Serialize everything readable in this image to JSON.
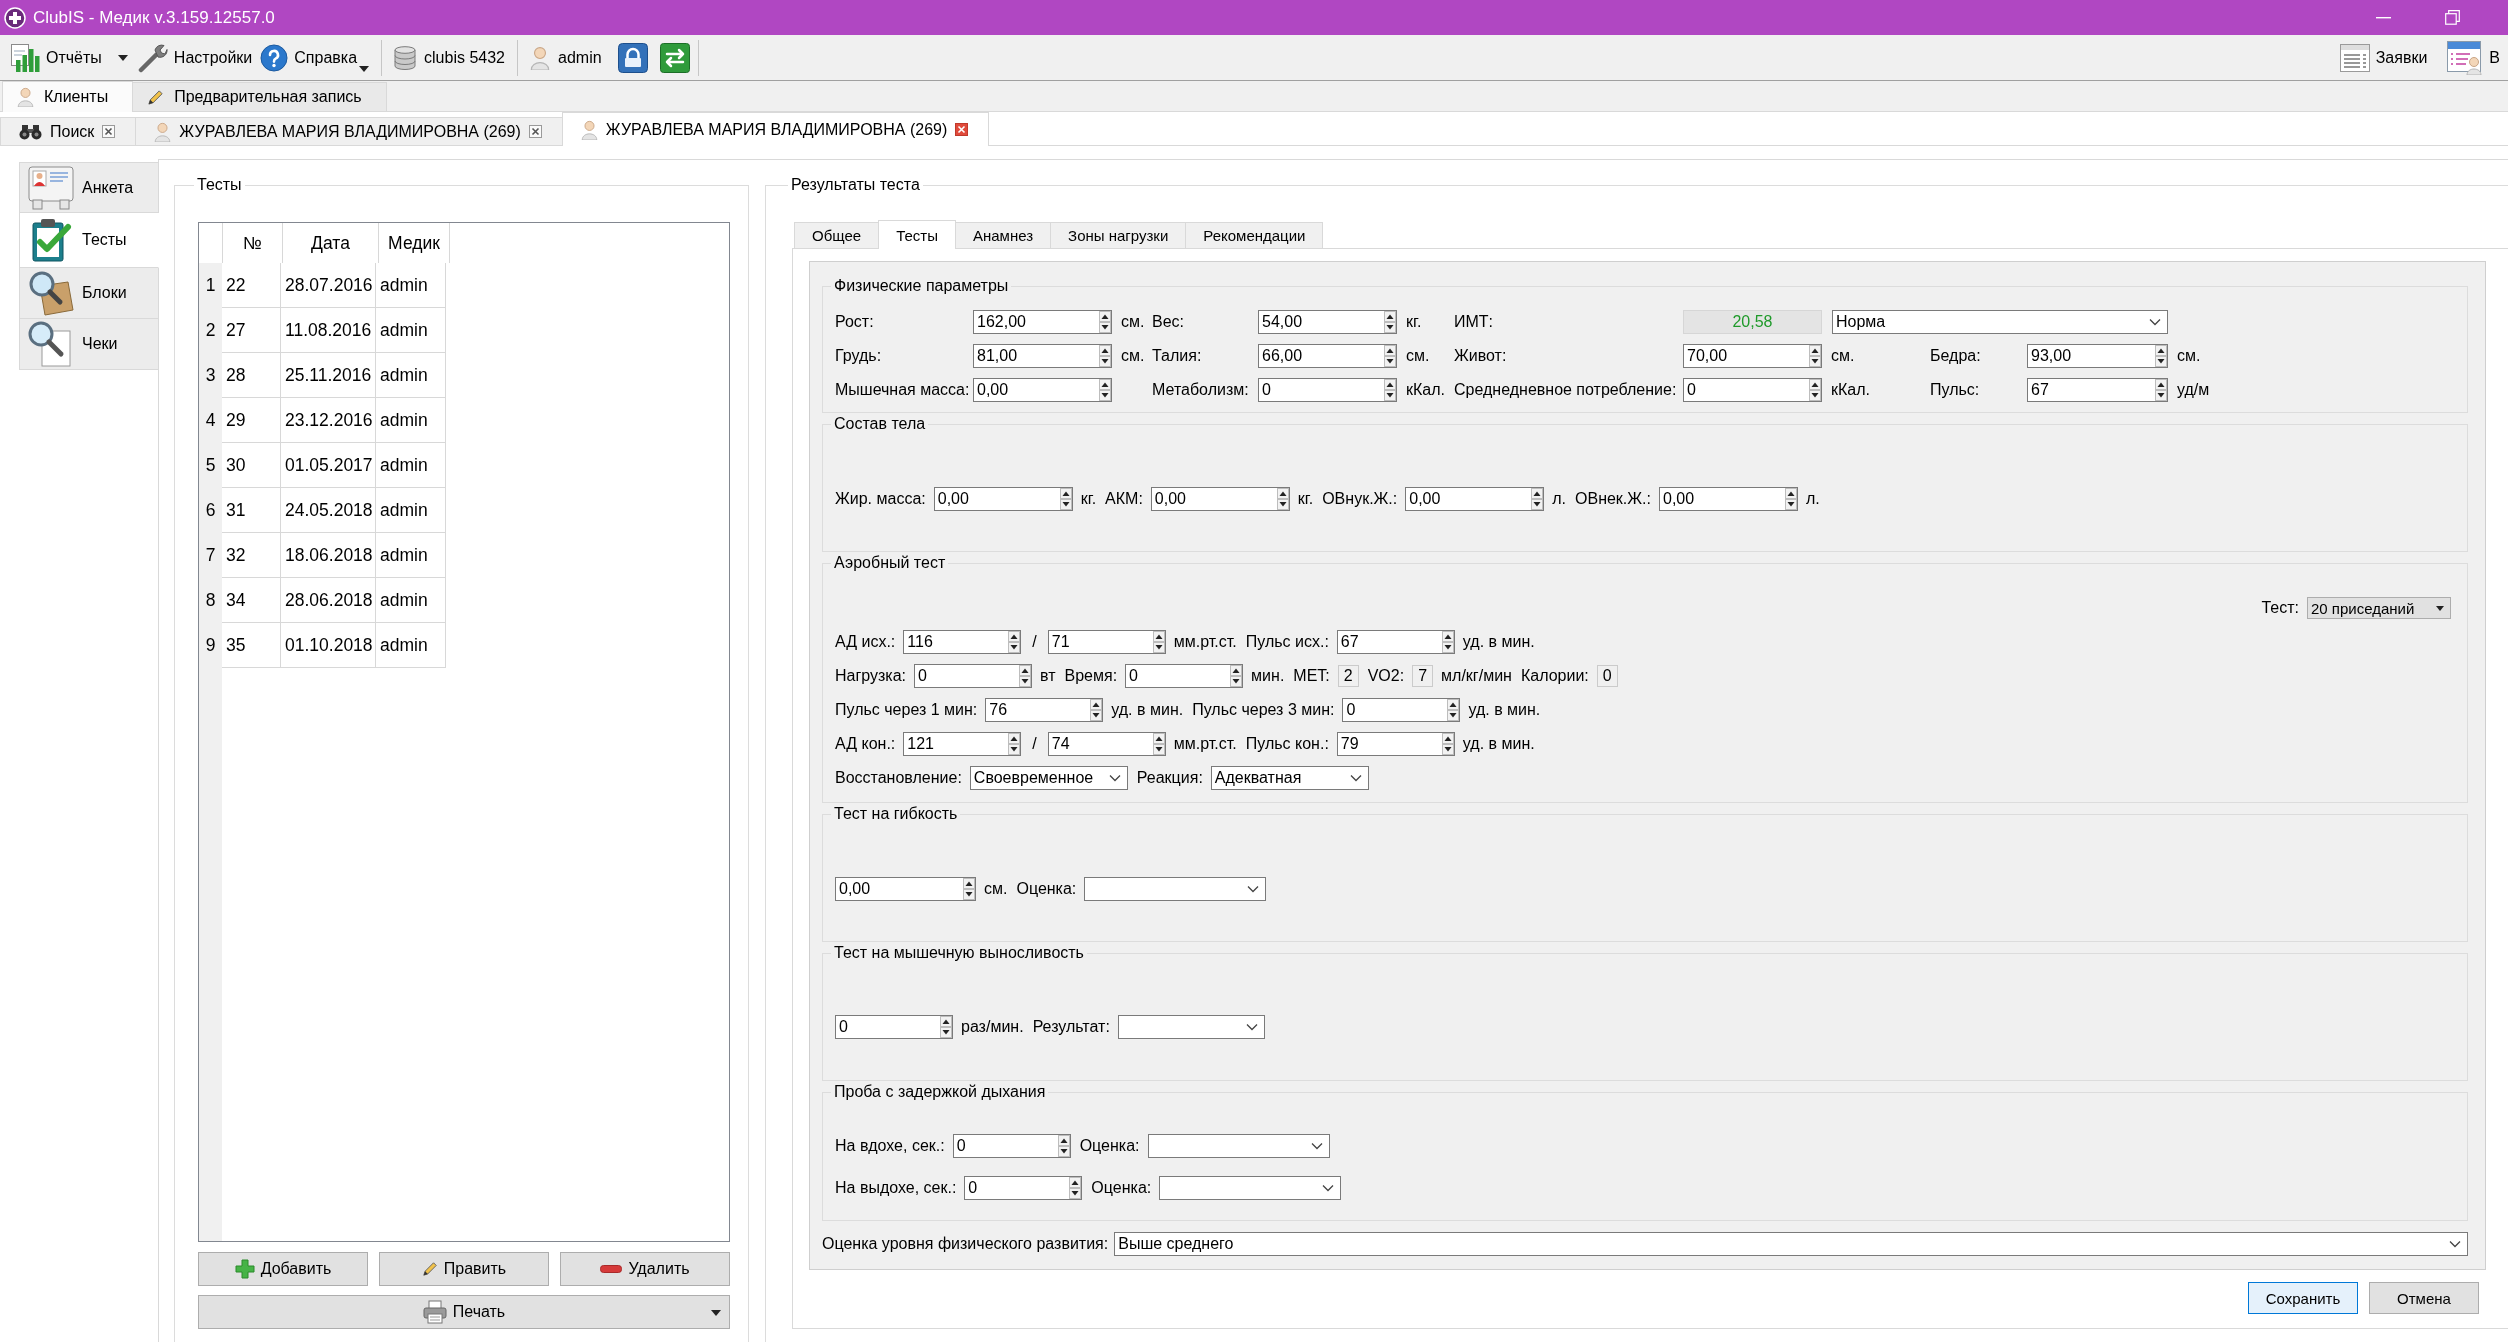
{
  "window": {
    "title": "ClubIS - Медик v.3.159.12557.0"
  },
  "toolbar": {
    "left": [
      {
        "kind": "split",
        "label": "Отчёты"
      },
      {
        "kind": "button",
        "label": "Настройки"
      },
      {
        "kind": "menu",
        "label": "Справка"
      },
      {
        "kind": "status",
        "label": "clubis 5432"
      },
      {
        "kind": "status",
        "label": "admin"
      }
    ],
    "right": [
      {
        "kind": "button",
        "label": "Заявки"
      },
      {
        "kind": "button",
        "label": "В"
      }
    ]
  },
  "main_tabs": [
    {
      "label": "Клиенты",
      "selected": true
    },
    {
      "label": "Предварительная запись",
      "selected": false
    }
  ],
  "document_tabs": [
    {
      "label": "Поиск",
      "selected": false
    },
    {
      "label": "ЖУРАВЛЕВА МАРИЯ ВЛАДИМИРОВНА (269)",
      "selected": false
    },
    {
      "label": "ЖУРАВЛЕВА МАРИЯ ВЛАДИМИРОВНА (269)",
      "selected": true
    }
  ],
  "sidebar": {
    "items": [
      {
        "label": "Анкета",
        "selected": false
      },
      {
        "label": "Тесты",
        "selected": true
      },
      {
        "label": "Блоки",
        "selected": false
      },
      {
        "label": "Чеки",
        "selected": false
      }
    ]
  },
  "tests_panel": {
    "title": "Тесты",
    "table": {
      "columns": [
        "№",
        "Дата",
        "Медик"
      ],
      "rows": [
        {
          "number": "1",
          "cells": [
            "22",
            "28.07.2016",
            "admin"
          ],
          "selected": false
        },
        {
          "number": "2",
          "cells": [
            "27",
            "11.08.2016",
            "admin"
          ],
          "selected": false
        },
        {
          "number": "3",
          "cells": [
            "28",
            "25.11.2016",
            "admin"
          ],
          "selected": false
        },
        {
          "number": "4",
          "cells": [
            "29",
            "23.12.2016",
            "admin"
          ],
          "selected": false
        },
        {
          "number": "5",
          "cells": [
            "30",
            "01.05.2017",
            "admin"
          ],
          "selected": false
        },
        {
          "number": "6",
          "cells": [
            "31",
            "24.05.2018",
            "admin"
          ],
          "selected": false
        },
        {
          "number": "7",
          "cells": [
            "32",
            "18.06.2018",
            "admin"
          ],
          "selected": false
        },
        {
          "number": "8",
          "cells": [
            "34",
            "28.06.2018",
            "admin"
          ],
          "selected": false
        },
        {
          "number": "9",
          "cells": [
            "35",
            "01.10.2018",
            "admin"
          ],
          "selected": false
        }
      ]
    },
    "buttons": [
      "Добавить",
      "Править",
      "Удалить"
    ],
    "print_button": "Печать"
  },
  "results_panel": {
    "title": "Результаты теста",
    "tabs": [
      {
        "label": "Общее",
        "selected": false
      },
      {
        "label": "Тесты",
        "selected": true
      },
      {
        "label": "Анамнез",
        "selected": false
      },
      {
        "label": "Зоны нагрузки",
        "selected": false
      },
      {
        "label": "Рекомендации",
        "selected": false
      }
    ],
    "sections": [
      {
        "title": "Физические параметры",
        "rows": [
          [
            {
              "label": "Рост:",
              "kind": "spin",
              "value": "162,00",
              "unit": "см."
            },
            {
              "label": "Вес:",
              "kind": "spin",
              "value": "54,00",
              "unit": "кг."
            },
            {
              "label": "ИМТ:",
              "kind": "result",
              "value": "20,58",
              "category": "Норма"
            }
          ],
          [
            {
              "label": "Грудь:",
              "kind": "spin",
              "value": "81,00",
              "unit": "см."
            },
            {
              "label": "Талия:",
              "kind": "spin",
              "value": "66,00",
              "unit": "см."
            },
            {
              "label": "Живот:",
              "kind": "spin",
              "value": "70,00",
              "unit": "см."
            },
            {
              "label": "Бедра:",
              "kind": "spin",
              "value": "93,00",
              "unit": "см."
            }
          ],
          [
            {
              "label": "Мышечная масса:",
              "kind": "spin",
              "value": "0,00"
            },
            {
              "label": "Метаболизм:",
              "kind": "spin",
              "value": "0",
              "unit": "кКал."
            },
            {
              "label": "Среднедневное потребление:",
              "kind": "spin",
              "value": "0",
              "unit": "кКал."
            },
            {
              "label": "Пульс:",
              "kind": "spin",
              "value": "67",
              "unit": "уд/м"
            }
          ]
        ]
      },
      {
        "title": "Состав тела",
        "rows": [
          [
            {
              "label": "Жир. масса:",
              "kind": "spin",
              "value": "0,00",
              "unit": "кг."
            },
            {
              "label": "АКМ:",
              "kind": "spin",
              "value": "0,00",
              "unit": "кг."
            },
            {
              "label": "ОВнук.Ж.:",
              "kind": "spin",
              "value": "0,00",
              "unit": "л."
            },
            {
              "label": "ОВнек.Ж.:",
              "kind": "spin",
              "value": "0,00",
              "unit": "л."
            }
          ]
        ]
      },
      {
        "title": "Аэробный тест",
        "selector": {
          "label": "Тест:",
          "value": "20 приседаний"
        },
        "rows": [
          [
            {
              "label": "АД исх.:",
              "kind": "pair",
              "values": [
                "116",
                "71"
              ],
              "separator": "/",
              "unit": "мм.рт.ст."
            },
            {
              "label": "Пульс исх.:",
              "kind": "spin",
              "value": "67",
              "unit": "уд. в мин."
            }
          ],
          [
            {
              "label": "Нагрузка:",
              "kind": "spin",
              "value": "0",
              "unit": "вт"
            },
            {
              "label": "Время:",
              "kind": "spin",
              "value": "0",
              "unit": "мин."
            },
            {
              "label": "MET:",
              "kind": "readout",
              "value": "2"
            },
            {
              "label": "VO2:",
              "kind": "readout",
              "value": "7",
              "unit": "мл/кг/мин"
            },
            {
              "label": "Калории:",
              "kind": "readout",
              "value": "0"
            }
          ],
          [
            {
              "label": "Пульс через 1 мин:",
              "kind": "spin",
              "value": "76",
              "unit": "уд. в мин."
            },
            {
              "label": "Пульс через 3 мин:",
              "kind": "spin",
              "value": "0",
              "unit": "уд. в мин."
            }
          ],
          [
            {
              "label": "АД кон.:",
              "kind": "pair",
              "values": [
                "121",
                "74"
              ],
              "separator": "/",
              "unit": "мм.рт.ст."
            },
            {
              "label": "Пульс кон.:",
              "kind": "spin",
              "value": "79",
              "unit": "уд. в мин."
            }
          ],
          [
            {
              "label": "Восстановление:",
              "kind": "combo",
              "value": "Своевременное"
            },
            {
              "label": "Реакция:",
              "kind": "combo",
              "value": "Адекватная"
            }
          ]
        ]
      },
      {
        "title": "Тест на гибкость",
        "rows": [
          [
            {
              "kind": "spin",
              "value": "0,00",
              "unit": "см."
            },
            {
              "label": "Оценка:",
              "kind": "combo"
            }
          ]
        ]
      },
      {
        "title": "Тест на мышечную выносливость",
        "rows": [
          [
            {
              "kind": "spin",
              "value": "0",
              "unit": "раз/мин."
            },
            {
              "label": "Результат:",
              "kind": "combo"
            }
          ]
        ]
      },
      {
        "title": "Проба с задержкой дыхания",
        "rows": [
          [
            {
              "label": "На вдохе, сек.:",
              "kind": "spin",
              "value": "0"
            },
            {
              "label": "Оценка:",
              "kind": "combo"
            }
          ],
          [
            {
              "label": "На выдохе, сек.:",
              "kind": "spin",
              "value": "0"
            },
            {
              "label": "Оценка:",
              "kind": "combo"
            }
          ]
        ]
      }
    ],
    "overall": {
      "label": "Оценка уровня физического развития:",
      "value": "Выше среднего"
    },
    "buttons": [
      {
        "label": "Сохранить",
        "default": true
      },
      {
        "label": "Отмена",
        "default": false
      }
    ]
  }
}
